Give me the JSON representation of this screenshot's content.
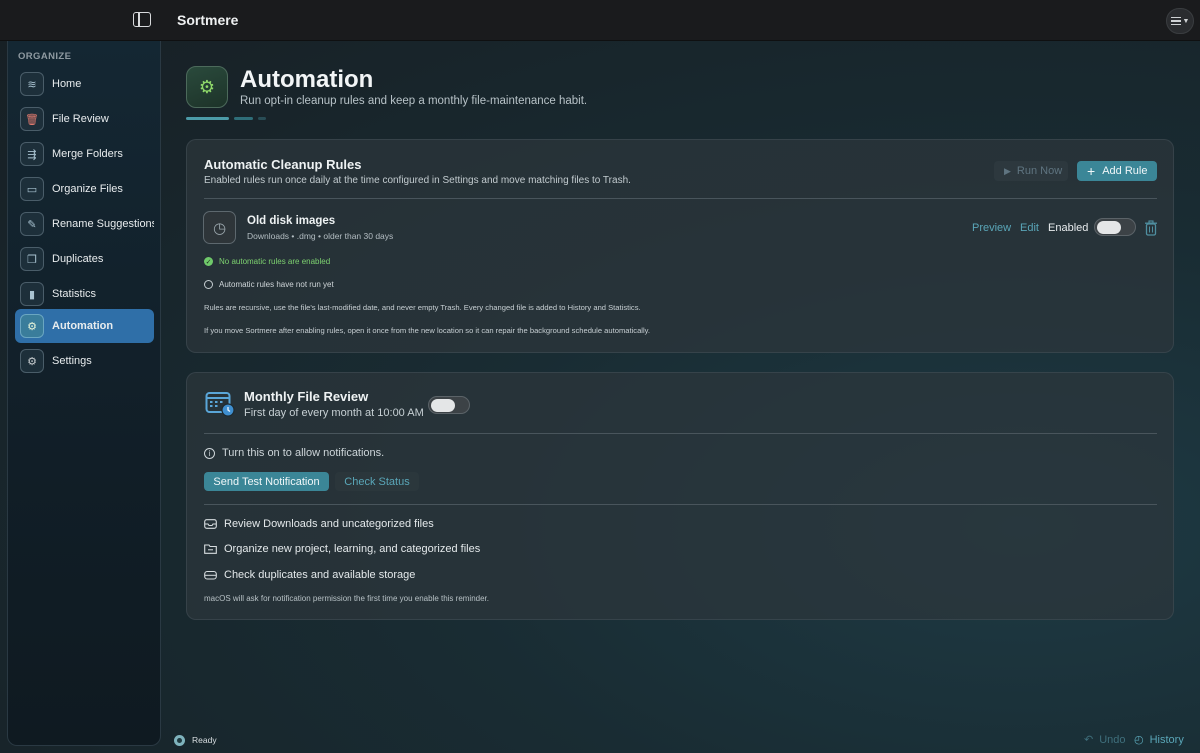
{
  "app": {
    "title": "Sortmere"
  },
  "sidebar": {
    "heading": "ORGANIZE",
    "items": [
      {
        "label": "Home",
        "icon": "waves-icon"
      },
      {
        "label": "File Review",
        "icon": "trash-icon"
      },
      {
        "label": "Merge Folders",
        "icon": "folder-merge-icon"
      },
      {
        "label": "Organize Files",
        "icon": "folder-icon"
      },
      {
        "label": "Rename Suggestions",
        "icon": "rename-icon"
      },
      {
        "label": "Duplicates",
        "icon": "duplicate-icon"
      },
      {
        "label": "Statistics",
        "icon": "bar-chart-icon"
      },
      {
        "label": "Automation",
        "icon": "gears-icon",
        "active": true
      },
      {
        "label": "Settings",
        "icon": "gear-icon"
      }
    ]
  },
  "header": {
    "title": "Automation",
    "subtitle": "Run opt-in cleanup rules and keep a monthly file-maintenance habit."
  },
  "cleanup": {
    "title": "Automatic Cleanup Rules",
    "subtitle": "Enabled rules run once daily at the time configured in Settings and move matching files to Trash.",
    "run_now_label": "Run Now",
    "add_rule_label": "Add Rule",
    "rule": {
      "name": "Old disk images",
      "meta": "Downloads • .dmg • older than 30 days",
      "preview_label": "Preview",
      "edit_label": "Edit",
      "enabled_label": "Enabled",
      "enabled": false
    },
    "status_enabled": "No automatic rules are enabled",
    "status_run": "Automatic rules have not run yet",
    "note1": "Rules are recursive, use the file's last-modified date, and never empty Trash. Every changed file is added to History and Statistics.",
    "note2": "If you move Sortmere after enabling rules, open it once from the new location so it can repair the background schedule automatically."
  },
  "monthly": {
    "title": "Monthly File Review",
    "subtitle": "First day of every month at 10:00 AM",
    "enabled": false,
    "info": "Turn this on to allow notifications.",
    "send_test_label": "Send Test Notification",
    "check_status_label": "Check Status",
    "tasks": [
      "Review Downloads and uncategorized files",
      "Organize new project, learning, and categorized files",
      "Check duplicates and available storage"
    ],
    "footnote": "macOS will ask for notification permission the first time you enable this reminder."
  },
  "statusbar": {
    "status": "Ready",
    "undo_label": "Undo",
    "history_label": "History"
  },
  "colors": {
    "accent": "#3b8697",
    "link": "#5aa6b8",
    "active_nav": "#2f6fa8",
    "success": "#6fc96a"
  }
}
